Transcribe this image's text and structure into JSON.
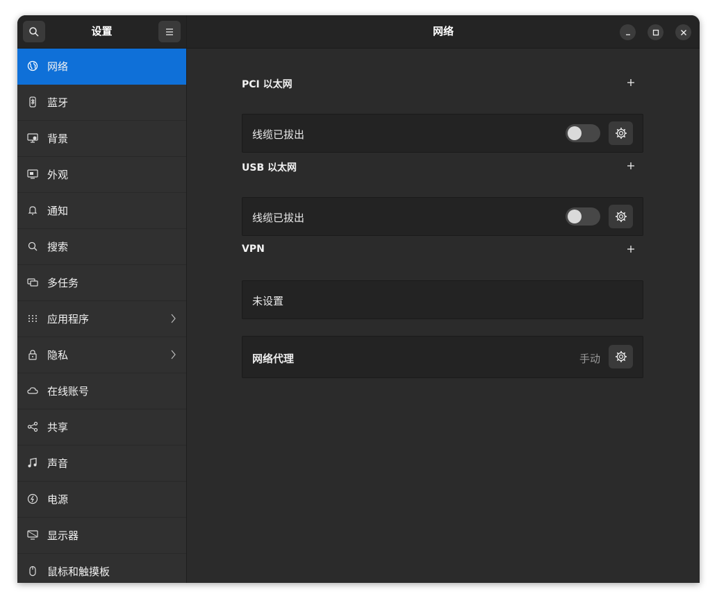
{
  "sidebar": {
    "title": "设置",
    "items": [
      {
        "label": "网络",
        "icon": "globe-icon",
        "active": true,
        "chevron": false
      },
      {
        "label": "蓝牙",
        "icon": "bluetooth-icon",
        "active": false,
        "chevron": false
      },
      {
        "label": "背景",
        "icon": "monitor-background-icon",
        "active": false,
        "chevron": false
      },
      {
        "label": "外观",
        "icon": "appearance-icon",
        "active": false,
        "chevron": false
      },
      {
        "label": "通知",
        "icon": "bell-icon",
        "active": false,
        "chevron": false
      },
      {
        "label": "搜索",
        "icon": "search-icon",
        "active": false,
        "chevron": false
      },
      {
        "label": "多任务",
        "icon": "multitasking-icon",
        "active": false,
        "chevron": false
      },
      {
        "label": "应用程序",
        "icon": "apps-grid-icon",
        "active": false,
        "chevron": true
      },
      {
        "label": "隐私",
        "icon": "lock-icon",
        "active": false,
        "chevron": true
      },
      {
        "label": "在线账号",
        "icon": "cloud-icon",
        "active": false,
        "chevron": false
      },
      {
        "label": "共享",
        "icon": "share-icon",
        "active": false,
        "chevron": false
      },
      {
        "label": "声音",
        "icon": "music-note-icon",
        "active": false,
        "chevron": false
      },
      {
        "label": "电源",
        "icon": "power-icon",
        "active": false,
        "chevron": false
      },
      {
        "label": "显示器",
        "icon": "display-icon",
        "active": false,
        "chevron": false
      },
      {
        "label": "鼠标和触摸板",
        "icon": "mouse-icon",
        "active": false,
        "chevron": false
      }
    ]
  },
  "header": {
    "title": "网络"
  },
  "sections": {
    "pci": {
      "title": "PCI 以太网",
      "status": "线缆已拔出",
      "enabled": false
    },
    "usb": {
      "title": "USB 以太网",
      "status": "线缆已拔出",
      "enabled": false
    },
    "vpn": {
      "title": "VPN",
      "status": "未设置"
    },
    "proxy": {
      "label": "网络代理",
      "value": "手动"
    }
  },
  "colors": {
    "accent": "#0f70d8",
    "window_bg": "#2b2b2b",
    "sidebar_bg": "#303030",
    "card_bg": "#232323"
  }
}
